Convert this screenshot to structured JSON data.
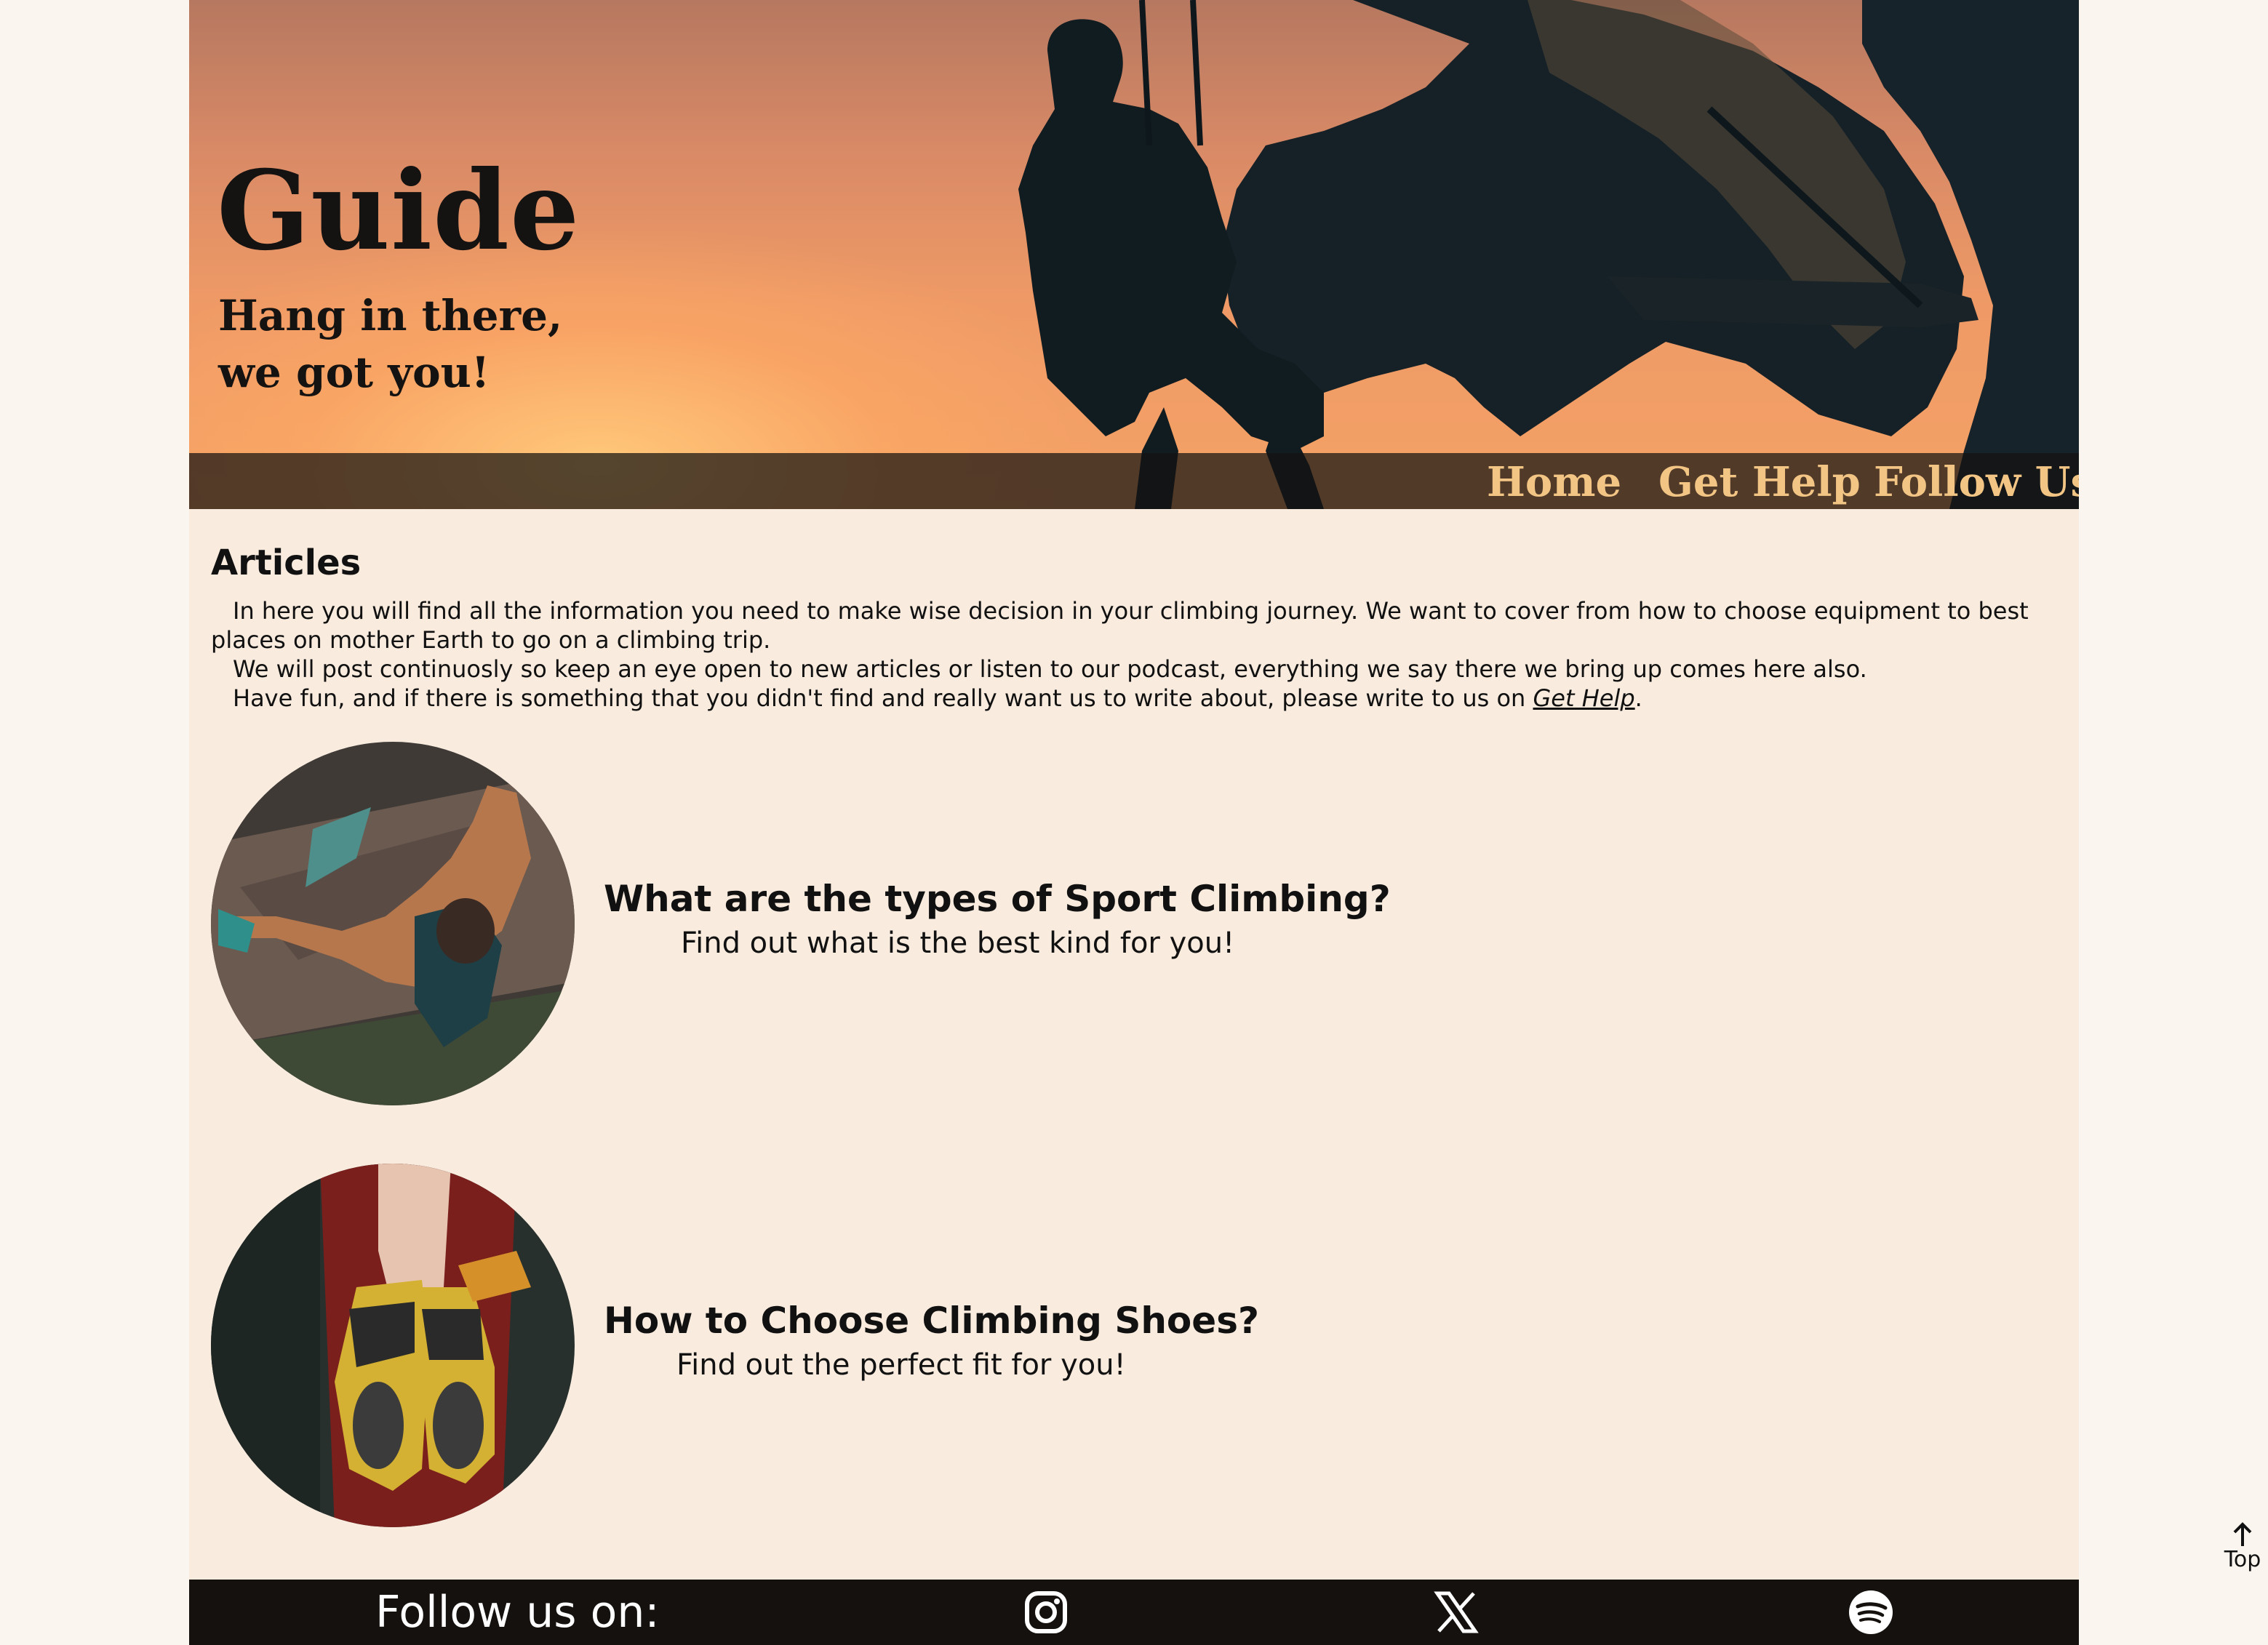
{
  "hero": {
    "title": "Guide",
    "subtitle_line1": "Hang in there,",
    "subtitle_line2": "we got you!"
  },
  "nav": {
    "items": [
      {
        "label": "Home"
      },
      {
        "label": "Get Help"
      },
      {
        "label": "Follow Us"
      }
    ]
  },
  "articles_section": {
    "title": "Articles",
    "intro": {
      "p1": "In here you will find all the information you need to make wise decision in your climbing journey. We want to cover from how to choose equipment to best places on mother Earth to go on a climbing trip.",
      "p2": "We will post continuosly so keep an eye open to new articles or listen to our podcast, everything we say there we bring up comes here also.",
      "p3_before": "Have fun, and if there is something that you didn't find and really want us to write about, please write to us on ",
      "p3_link": "Get Help",
      "p3_after": "."
    },
    "items": [
      {
        "title": "What are the types of Sport Climbing?",
        "subtitle": "Find out what is the best kind for you!"
      },
      {
        "title": "How to Choose Climbing Shoes?",
        "subtitle": "Find out the perfect fit for you!"
      }
    ]
  },
  "footer": {
    "label": "Follow us on:",
    "social": [
      {
        "icon": "instagram-icon"
      },
      {
        "icon": "x-icon"
      },
      {
        "icon": "spotify-icon"
      }
    ]
  },
  "top_button": {
    "label": "Top"
  },
  "colors": {
    "page_bg": "#faf5ef",
    "content_bg": "#f9ecdf",
    "nav_text": "#f2c585",
    "footer_bg": "#14110e"
  }
}
